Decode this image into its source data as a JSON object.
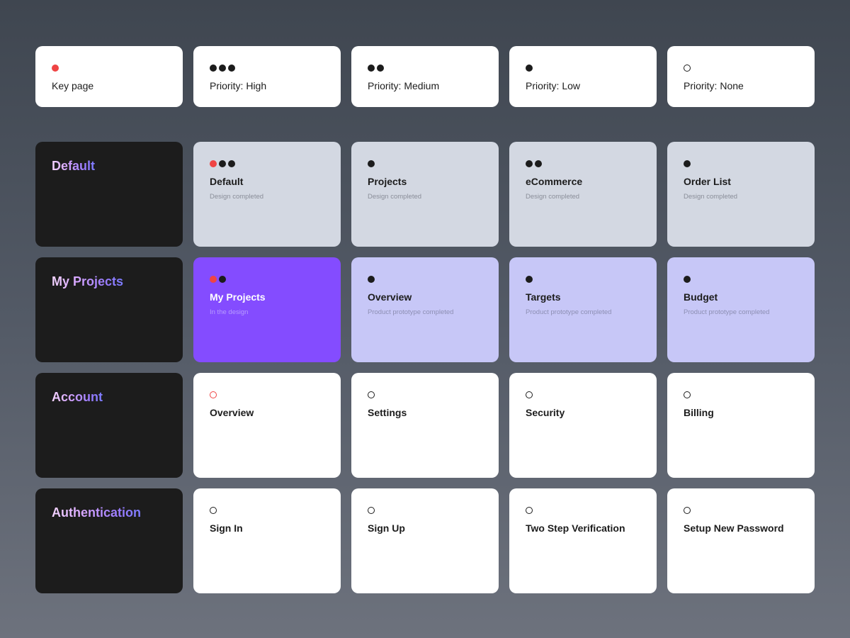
{
  "colors": {
    "key_red": "#ef4444",
    "dot_black": "#1c1c1c",
    "done_grey": "#d3d8e2",
    "prototype_lavender": "#c7c7f7",
    "in_design_purple": "#844cff",
    "section_dark": "#1c1c1c"
  },
  "legend": [
    {
      "label": "Key page",
      "marker": "key-dot"
    },
    {
      "label": "Priority: High",
      "marker": "three-dots"
    },
    {
      "label": "Priority: Medium",
      "marker": "two-dots"
    },
    {
      "label": "Priority: Low",
      "marker": "one-dot"
    },
    {
      "label": "Priority: None",
      "marker": "empty-circle"
    }
  ],
  "sections": [
    {
      "title": "Default",
      "pages": [
        {
          "title": "Default",
          "status": "Design completed"
        },
        {
          "title": "Projects",
          "status": "Design completed"
        },
        {
          "title": "eCommerce",
          "status": "Design completed"
        },
        {
          "title": "Order List",
          "status": "Design completed"
        }
      ]
    },
    {
      "title": "My Projects",
      "pages": [
        {
          "title": "My Projects",
          "status": "In the design"
        },
        {
          "title": "Overview",
          "status": "Product prototype completed"
        },
        {
          "title": "Targets",
          "status": "Product prototype completed"
        },
        {
          "title": "Budget",
          "status": "Product prototype completed"
        }
      ]
    },
    {
      "title": "Account",
      "pages": [
        {
          "title": "Overview",
          "status": ""
        },
        {
          "title": "Settings",
          "status": ""
        },
        {
          "title": "Security",
          "status": ""
        },
        {
          "title": "Billing",
          "status": ""
        }
      ]
    },
    {
      "title": "Authentication",
      "pages": [
        {
          "title": "Sign In",
          "status": ""
        },
        {
          "title": "Sign Up",
          "status": ""
        },
        {
          "title": "Two Step Verification",
          "status": ""
        },
        {
          "title": "Setup New Password",
          "status": ""
        }
      ]
    }
  ]
}
